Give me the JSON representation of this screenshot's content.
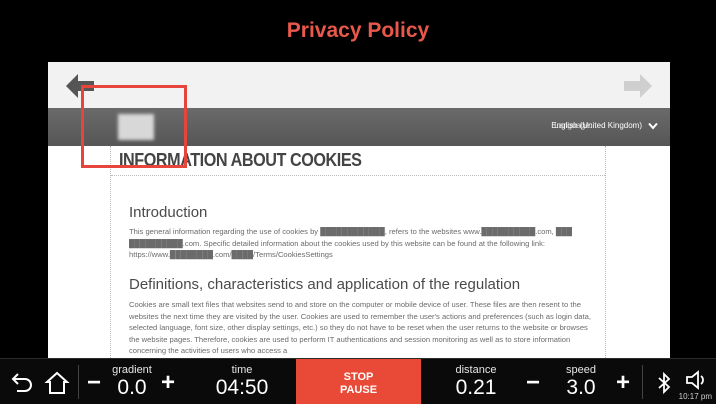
{
  "header": {
    "title": "Privacy Policy"
  },
  "site": {
    "language_label": "Language:",
    "language_value": "English (United Kingdom)"
  },
  "page": {
    "heading": "INFORMATION ABOUT COOKIES",
    "sections": [
      {
        "title": "Introduction",
        "body": "This general information regarding the use of cookies by ████████████, refers to the websites www.██████████.com, ███ ██████████.com. Specific detailed information about the cookies used by this website can be found at the following link: https://www.████████.com/████/Terms/CookiesSettings"
      },
      {
        "title": "Definitions, characteristics and application of the regulation",
        "body": "Cookies are small text files that websites send to and store on the computer or mobile device of user. These files are then resent to the websites the next time they are visited by the user. Cookies are used to remember the user's actions and preferences (such as login data, selected language, font size, other display settings, etc.) so they do not have to be reset when the user returns to the website or browses the website pages. Therefore, cookies are used to perform IT authentications and session monitoring as well as to store information concerning the activities of users who access a"
      }
    ]
  },
  "controls": {
    "gradient": {
      "label": "gradient",
      "value": "0.0"
    },
    "time": {
      "label": "time",
      "value": "04:50"
    },
    "stop": {
      "line1": "STOP",
      "line2": "PAUSE"
    },
    "distance": {
      "label": "distance",
      "value": "0.21"
    },
    "speed": {
      "label": "speed",
      "value": "3.0"
    },
    "minus": "−",
    "plus": "+"
  },
  "status": {
    "clock": "10:17 pm"
  },
  "colors": {
    "accent": "#e9584a",
    "stop_button": "#e84a37",
    "bar_bg": "#0a0a0a"
  }
}
